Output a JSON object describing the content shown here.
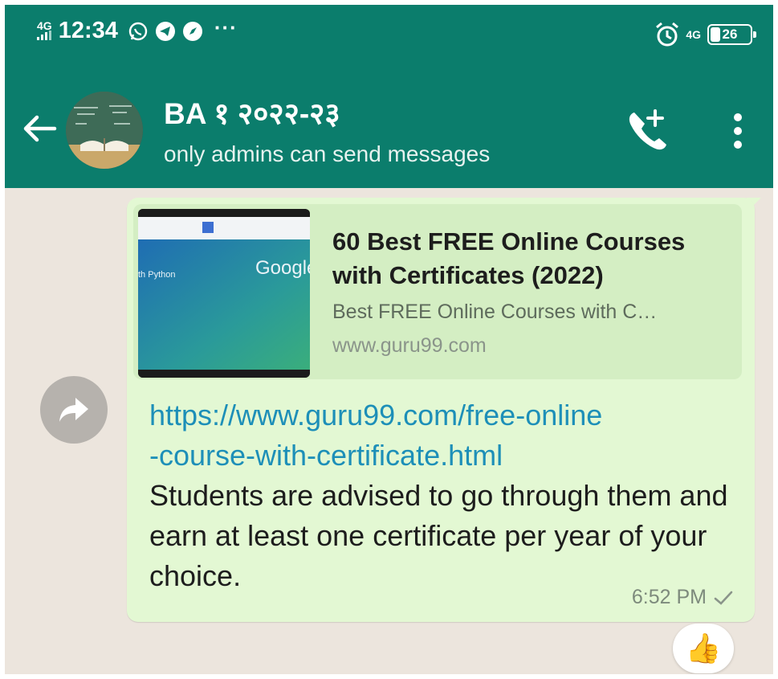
{
  "status_bar": {
    "network": "4G",
    "time": "12:34",
    "notif_icons": [
      "whatsapp-icon",
      "telegram-icon",
      "compass-icon"
    ],
    "more": "···",
    "right_network": "4G",
    "battery": "26"
  },
  "header": {
    "title": "BA १ २०२२-२३",
    "subtitle": "only admins can send messages"
  },
  "message": {
    "preview": {
      "title": "60 Best FREE Online Courses with Certificates (2022)",
      "description": "Best FREE Online Courses with C…",
      "domain": "www.guru99.com",
      "thumb_text_left": "th Python",
      "thumb_text_right": "Google"
    },
    "link": "https://www.guru99.com/free-online-course-with-certificate.html",
    "link_line1": "https://www.guru99.com/free-online",
    "link_line2": "-course-with-certificate.html",
    "body": "Students are advised to go through them and earn at least one certificate per year of your choice.",
    "time": "6:52 PM",
    "reaction": "👍"
  },
  "colors": {
    "header_bg": "#0b7d6c",
    "bubble_bg": "#e3f8d3",
    "link": "#1d8fb8"
  }
}
